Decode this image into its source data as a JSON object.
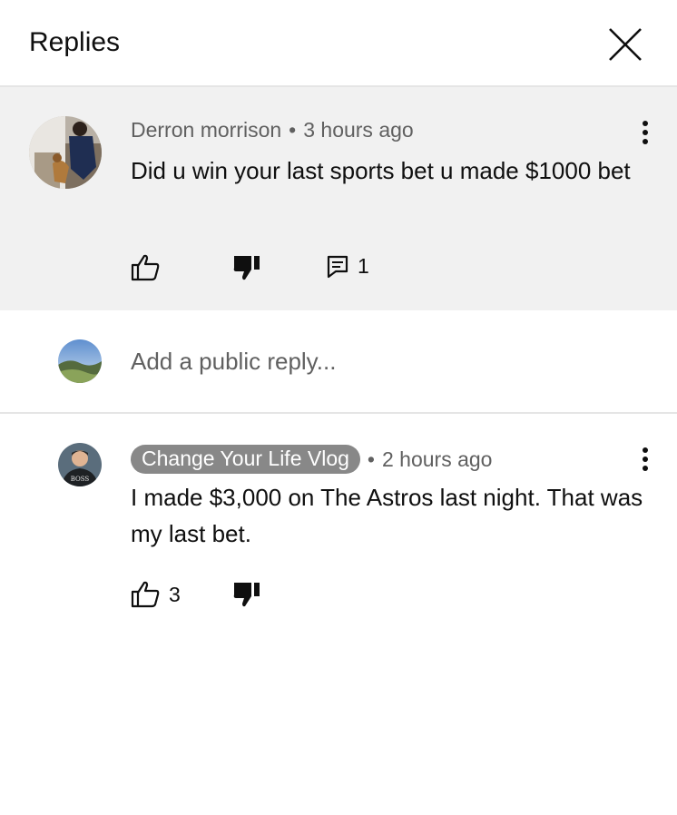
{
  "header": {
    "title": "Replies"
  },
  "parent_comment": {
    "author": "Derron morrison",
    "separator": "•",
    "time": "3 hours ago",
    "text": "Did u win your last sports bet u made $1000 bet",
    "like_count": "",
    "reply_count": "1"
  },
  "reply_box": {
    "placeholder": "Add a public reply..."
  },
  "replies": [
    {
      "author": "Change Your Life Vlog",
      "separator": "•",
      "time": "2 hours ago",
      "text": "I made $3,000 on The Astros last night. That was my last bet.",
      "like_count": "3"
    }
  ],
  "colors": {
    "parent_bg": "#f1f1f1",
    "pill_bg": "#888888",
    "meta_text": "#606060"
  }
}
